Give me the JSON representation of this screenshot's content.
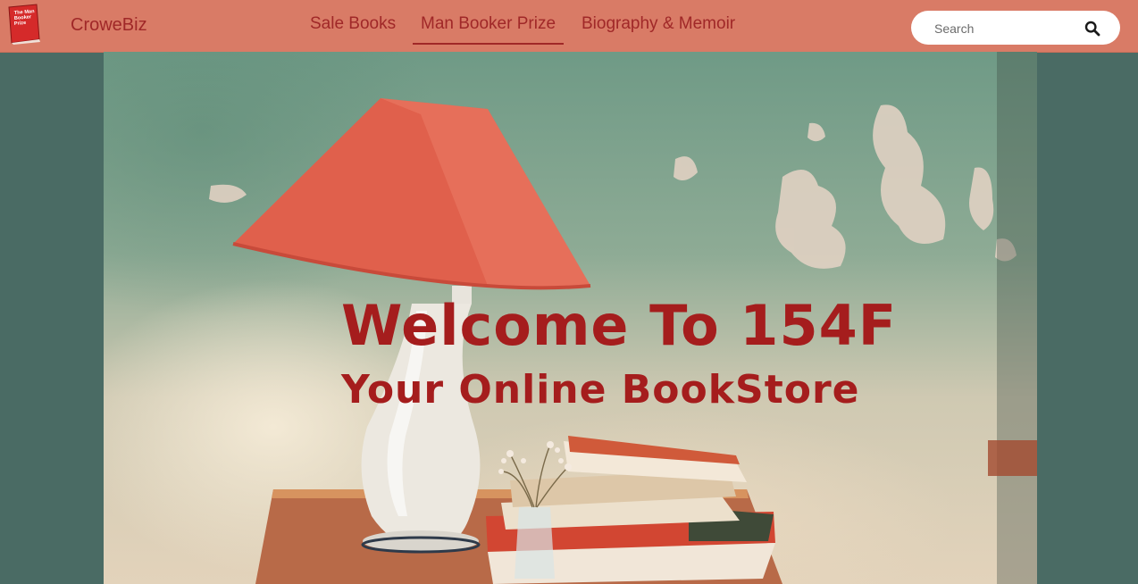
{
  "navbar": {
    "logo_text": "The Man Booker Prize",
    "brand": "CroweBiz",
    "links": [
      {
        "label": "Sale Books",
        "active": false
      },
      {
        "label": "Man Booker Prize",
        "active": true
      },
      {
        "label": "Biography & Memoir",
        "active": false
      }
    ],
    "search": {
      "placeholder": "Search",
      "value": "",
      "icon": "search-icon"
    }
  },
  "hero": {
    "title": "Welcome To 154F",
    "subtitle": "Your Online BookStore",
    "image_description_icons": [
      "lamp",
      "books",
      "flowers"
    ]
  },
  "colors": {
    "navbar_bg": "#d97b66",
    "accent": "#a02828",
    "page_bg": "#4a6b64"
  }
}
